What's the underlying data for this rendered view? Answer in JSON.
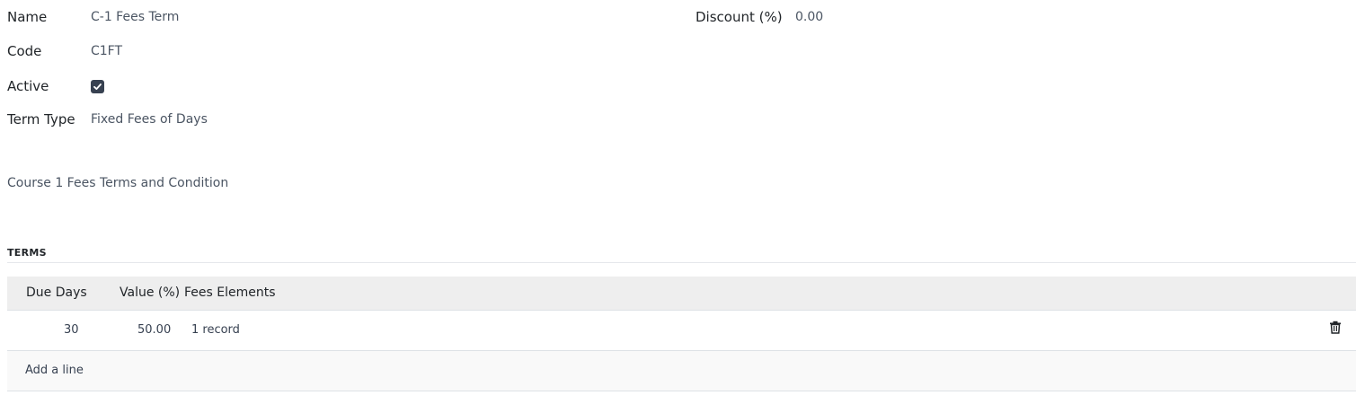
{
  "form": {
    "name_label": "Name",
    "name_value": "C-1 Fees Term",
    "code_label": "Code",
    "code_value": "C1FT",
    "active_label": "Active",
    "active_checked": true,
    "term_type_label": "Term Type",
    "term_type_value": "Fixed Fees of Days",
    "discount_label": "Discount (%)",
    "discount_value": "0.00",
    "description": "Course 1 Fees Terms and Condition"
  },
  "terms": {
    "section_title": "TERMS",
    "columns": [
      "Due Days",
      "Value (%)",
      "Fees Elements"
    ],
    "rows": [
      {
        "due_days": "30",
        "value": "50.00",
        "fees_elements": "1 record",
        "delete_icon": "trash-icon"
      }
    ],
    "add_line_label": "Add a line"
  },
  "colors": {
    "checkbox_fill": "#374151",
    "header_bg": "#eeeeee",
    "add_row_bg": "#f9f9f9"
  }
}
